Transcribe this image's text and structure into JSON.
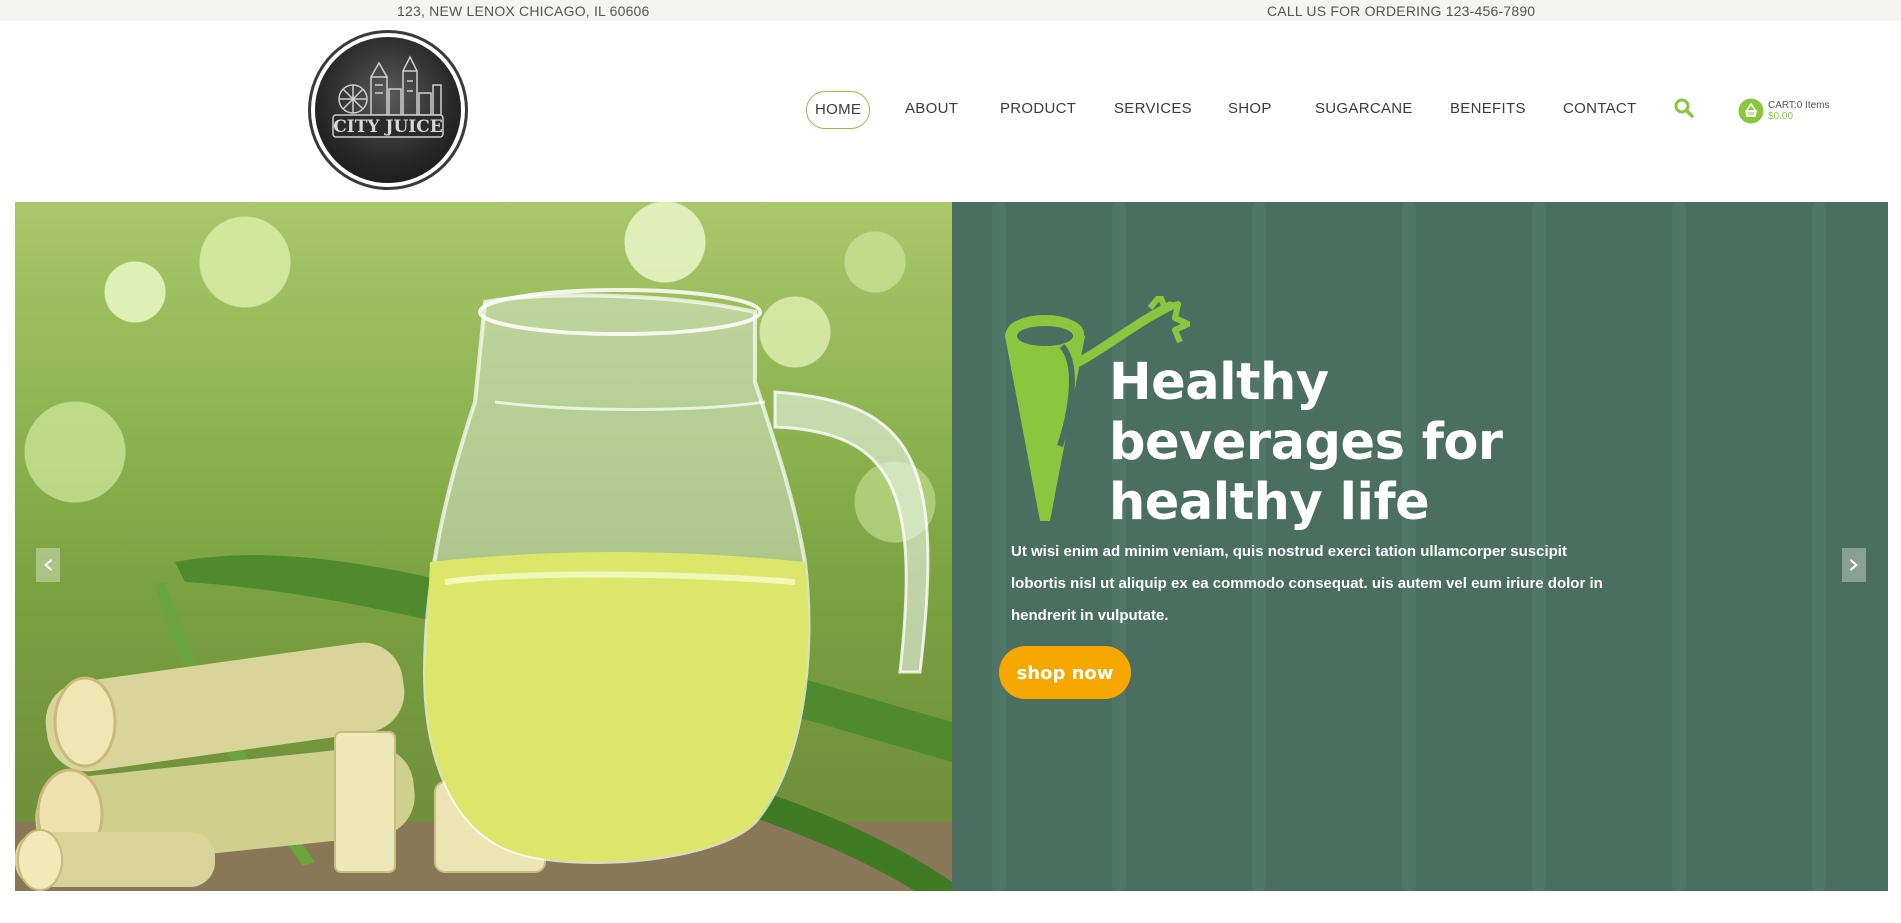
{
  "topbar": {
    "address": "123, NEW LENOX CHICAGO, IL 60606",
    "phone": "CALL US FOR ORDERING 123-456-7890"
  },
  "logo": {
    "text": "CITY JUICE"
  },
  "nav": {
    "items": [
      {
        "label": "HOME",
        "active": true
      },
      {
        "label": "ABOUT"
      },
      {
        "label": "PRODUCT"
      },
      {
        "label": "SERVICES"
      },
      {
        "label": "SHOP"
      },
      {
        "label": "SUGARCANE"
      },
      {
        "label": "BENEFITS"
      },
      {
        "label": "CONTACT"
      }
    ],
    "search_icon": "search-icon",
    "cart": {
      "label": "CART:0 Items",
      "total": "$0.00",
      "icon": "basket-icon"
    }
  },
  "hero": {
    "title": "Healthy beverages for healthy life",
    "text": "Ut wisi enim ad minim veniam, quis nostrud exerci tation ullamcorper suscipit lobortis nisl ut aliquip ex ea commodo consequat. uis autem vel eum iriure dolor in hendrerit in vulputate.",
    "button": "shop now",
    "prev_icon": "chevron-left-icon",
    "next_icon": "chevron-right-icon"
  },
  "colors": {
    "accent": "#8cc63f",
    "panel": "#4a6e60",
    "button": "#f6a800"
  }
}
